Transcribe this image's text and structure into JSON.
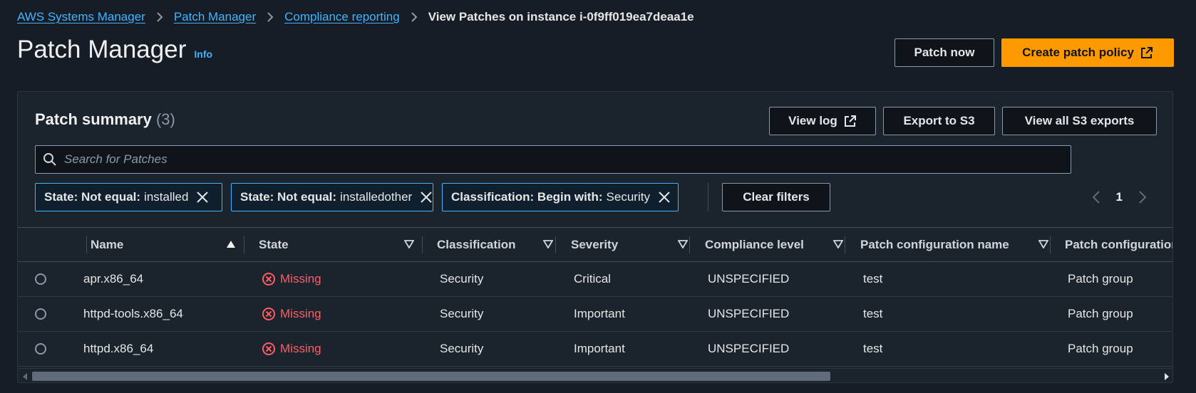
{
  "breadcrumb": {
    "items": [
      "AWS Systems Manager",
      "Patch Manager",
      "Compliance reporting"
    ],
    "current": "View Patches on instance i-0f9ff019ea7deaa1e"
  },
  "page": {
    "title": "Patch Manager",
    "info": "Info"
  },
  "header_actions": {
    "patch_now": "Patch now",
    "create_policy": "Create patch policy"
  },
  "panel": {
    "title": "Patch summary",
    "count": "(3)",
    "view_log": "View log",
    "export_s3": "Export to S3",
    "view_all_exports": "View all S3 exports",
    "search_placeholder": "Search for Patches",
    "clear_filters": "Clear filters",
    "current_page": "1"
  },
  "filters": [
    {
      "key": "State: Not equal:",
      "value": "installed"
    },
    {
      "key": "State: Not equal:",
      "value": "installedother"
    },
    {
      "key": "Classification: Begin with:",
      "value": "Security"
    }
  ],
  "table": {
    "columns": [
      "Name",
      "State",
      "Classification",
      "Severity",
      "Compliance level",
      "Patch configuration name",
      "Patch configuration"
    ],
    "rows": [
      {
        "name": "apr.x86_64",
        "state": "Missing",
        "classification": "Security",
        "severity": "Critical",
        "compliance": "UNSPECIFIED",
        "config_name": "test",
        "config": "Patch group"
      },
      {
        "name": "httpd-tools.x86_64",
        "state": "Missing",
        "classification": "Security",
        "severity": "Important",
        "compliance": "UNSPECIFIED",
        "config_name": "test",
        "config": "Patch group"
      },
      {
        "name": "httpd.x86_64",
        "state": "Missing",
        "classification": "Security",
        "severity": "Important",
        "compliance": "UNSPECIFIED",
        "config_name": "test",
        "config": "Patch group"
      }
    ]
  },
  "colors": {
    "accent": "#ff9900",
    "link": "#42b4ff",
    "missing": "#ff5d64",
    "background": "#161d26",
    "panel": "#1b232d"
  }
}
